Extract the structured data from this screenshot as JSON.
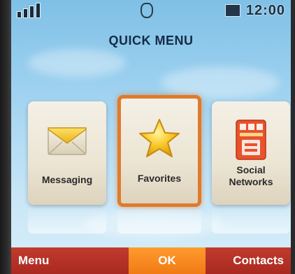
{
  "status_bar": {
    "signal_icon": "signal-bars-icon",
    "center_icon": "ring-icon",
    "message_icon": "message-icon",
    "battery_icon": "battery-icon",
    "time": "12:00"
  },
  "title": "QUICK MENU",
  "tiles": [
    {
      "label": "Messaging",
      "icon": "envelope-icon",
      "selected": false
    },
    {
      "label": "Favorites",
      "icon": "star-icon",
      "selected": true
    },
    {
      "label": "Social Networks",
      "icon": "social-networks-icon",
      "selected": false
    }
  ],
  "softkeys": {
    "left": "Menu",
    "center": "OK",
    "right": "Contacts"
  },
  "colors": {
    "accent": "#e07a2a",
    "softkey_bar": "#b5322a",
    "softkey_center": "#f58a1f",
    "title_text": "#152a45"
  }
}
